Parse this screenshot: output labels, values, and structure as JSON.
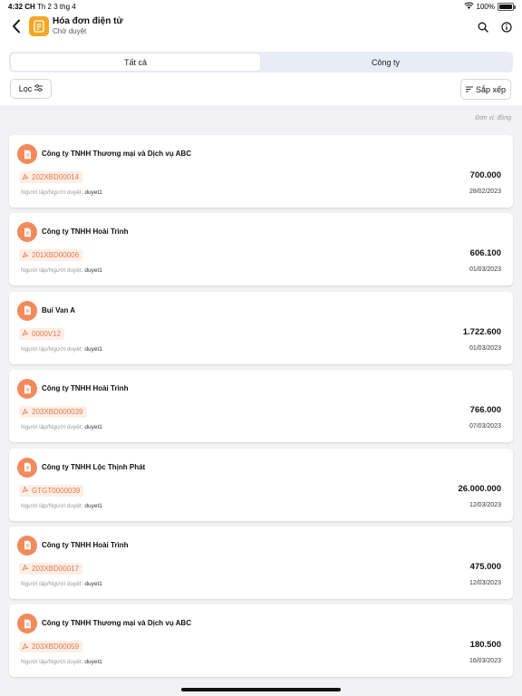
{
  "status_bar": {
    "time": "4:32 CH",
    "date": "Th 2 3 thg 4",
    "battery": "100%"
  },
  "header": {
    "title": "Hóa đơn điện tử",
    "subtitle": "Chờ duyệt"
  },
  "tabs": [
    {
      "label": "Tất cả",
      "active": true
    },
    {
      "label": "Công ty",
      "active": false
    }
  ],
  "filter_label": "Lọc",
  "sort_label": "Sắp xếp",
  "unit_label": "Đơn vị: đồng",
  "creator_label": "Người lập/Người duyệt:",
  "invoices": [
    {
      "company": "Công ty TNHH Thương mại và Dịch vụ ABC",
      "code": "202XBD00014",
      "amount": "700.000",
      "creator": "duyet1",
      "date": "28/02/2023"
    },
    {
      "company": "Công ty TNHH Hoài Trình",
      "code": "201XBD00006",
      "amount": "606.100",
      "creator": "duyet1",
      "date": "01/03/2023"
    },
    {
      "company": "Bui Van A",
      "code": "0000V12",
      "amount": "1.722.600",
      "creator": "duyet1",
      "date": "01/03/2023"
    },
    {
      "company": "Công ty TNHH Hoài Trình",
      "code": "203XBD000039",
      "amount": "766.000",
      "creator": "duyet1",
      "date": "07/03/2023"
    },
    {
      "company": "Công ty TNHH Lộc Thịnh Phát",
      "code": "GTGT0000039",
      "amount": "26.000.000",
      "creator": "duyet1",
      "date": "12/03/2023"
    },
    {
      "company": "Công ty TNHH Hoài Trình",
      "code": "203XBD00017",
      "amount": "475.000",
      "creator": "duyet1",
      "date": "12/03/2023"
    },
    {
      "company": "Công ty TNHH Thương mại và Dịch vụ ABC",
      "code": "203XBD00059",
      "amount": "180.500",
      "creator": "duyet1",
      "date": "16/03/2023"
    }
  ],
  "colors": {
    "accent": "#f28a5c",
    "app_icon": "#f5a623",
    "code_bg": "#fdeee6",
    "segment_bg": "#e9ecf5"
  }
}
